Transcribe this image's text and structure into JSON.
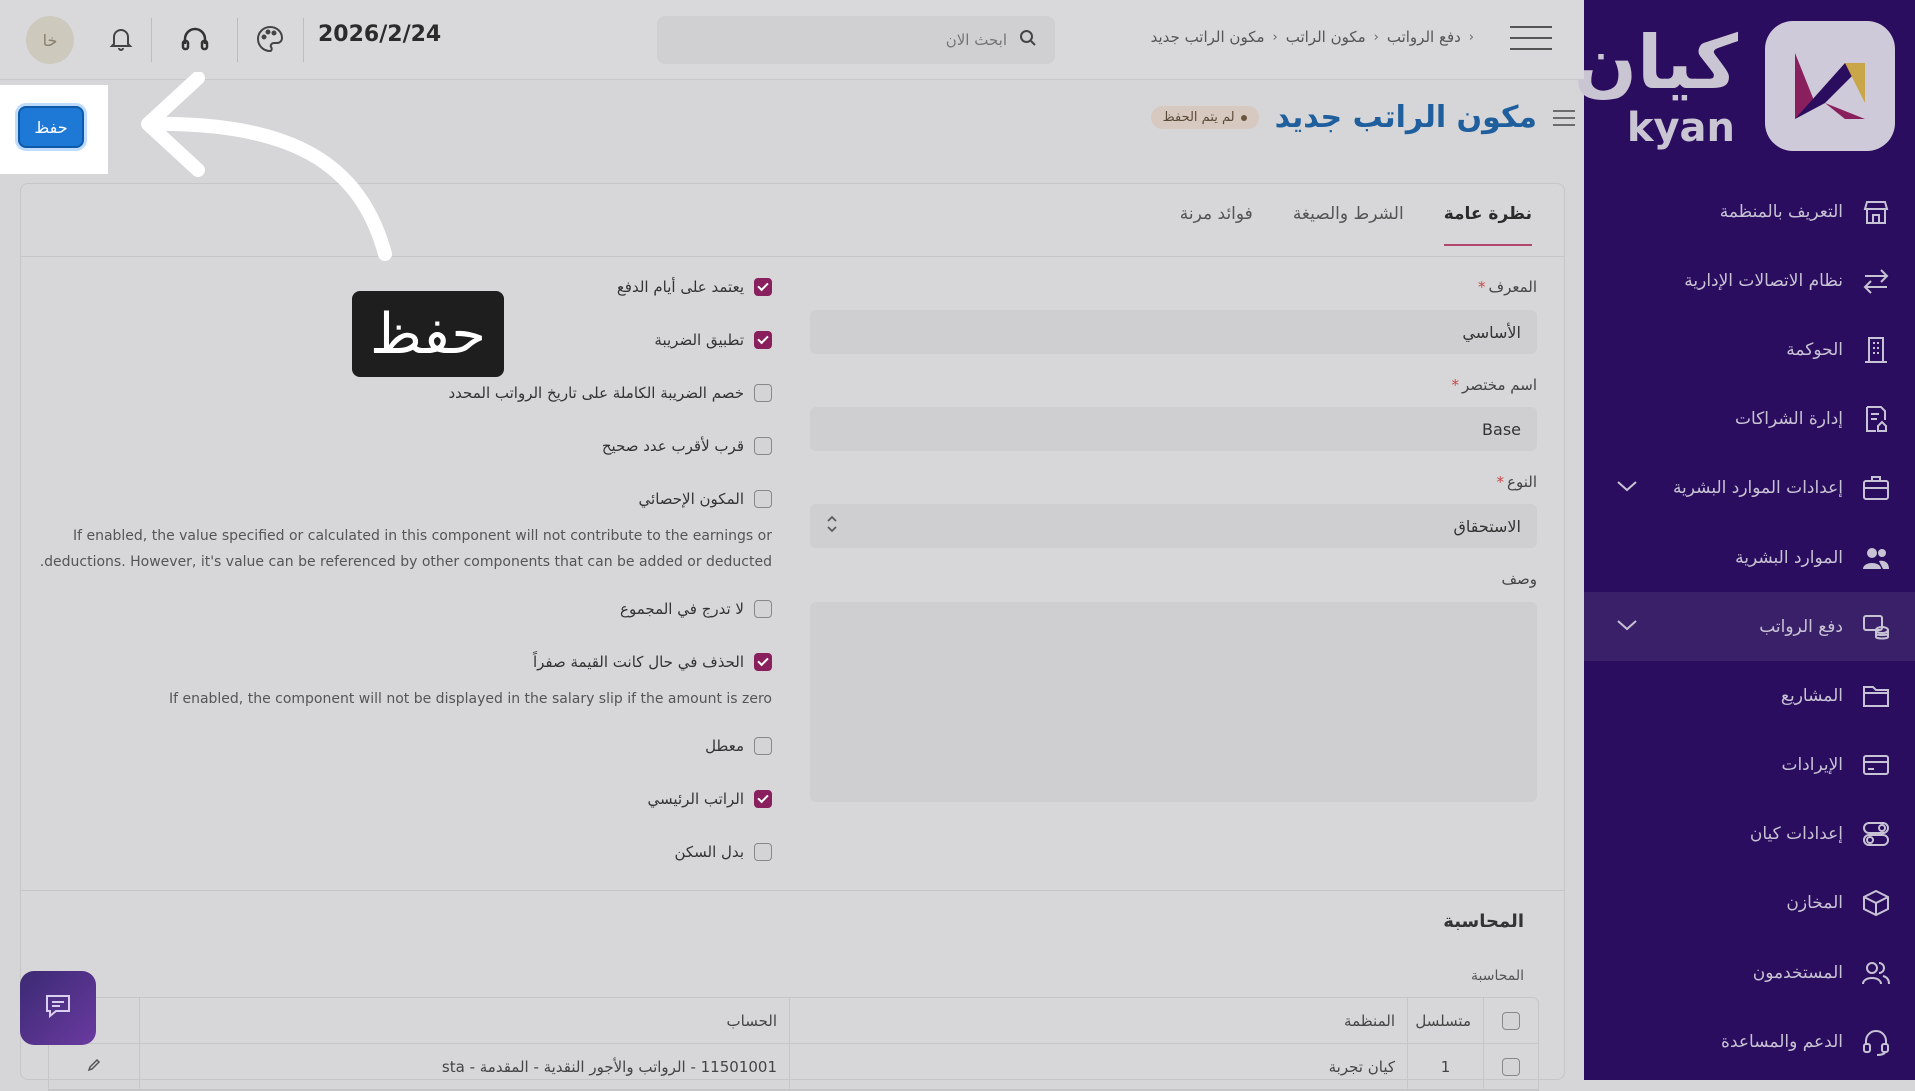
{
  "sidebar": {
    "logo_ar": "كيان",
    "logo_en": "kyan",
    "items": [
      {
        "label": "التعريف بالمنظمة",
        "icon": "store-icon"
      },
      {
        "label": "نظام الاتصالات الإدارية",
        "icon": "transfer-icon"
      },
      {
        "label": "الحوكمة",
        "icon": "building-icon"
      },
      {
        "label": "إدارة الشراكات",
        "icon": "document-home-icon"
      },
      {
        "label": "إعدادات الموارد البشرية",
        "icon": "briefcase-icon",
        "expandable": true
      },
      {
        "label": "الموارد البشرية",
        "icon": "users-icon"
      },
      {
        "label": "دفع الرواتب",
        "icon": "coins-icon",
        "expandable": true,
        "active": true
      },
      {
        "label": "المشاريع",
        "icon": "folder-icon"
      },
      {
        "label": "الإيرادات",
        "icon": "card-icon"
      },
      {
        "label": "إعدادات كيان",
        "icon": "toggles-icon"
      },
      {
        "label": "المخازن",
        "icon": "box-icon"
      },
      {
        "label": "المستخدمون",
        "icon": "user-group-icon"
      },
      {
        "label": "الدعم والمساعدة",
        "icon": "headset-icon"
      }
    ]
  },
  "topbar": {
    "breadcrumb": [
      "دفع الرواتب",
      "مكون الراتب",
      "مكون الراتب جديد"
    ],
    "search_placeholder": "ابحث الان",
    "date": "2026/2/24",
    "avatar": "خا"
  },
  "page": {
    "title": "مكون الراتب جديد",
    "status": "لم يتم الحفظ",
    "save_label": "حفظ",
    "tooltip": "حفظ"
  },
  "tabs": [
    "نظرة عامة",
    "الشرط والصيغة",
    "فوائد مرنة"
  ],
  "form": {
    "id_label": "المعرف",
    "id_value": "الأساسي",
    "abbr_label": "اسم مختصر",
    "abbr_value": "Base",
    "type_label": "النوع",
    "type_value": "الاستحقاق",
    "desc_label": "وصف"
  },
  "checkboxes": [
    {
      "label": "يعتمد على أيام الدفع",
      "checked": true
    },
    {
      "label": "تطبيق الضريبة",
      "checked": true
    },
    {
      "label": "خصم الضريبة الكاملة على تاريخ الرواتب المحدد",
      "checked": false
    },
    {
      "label": "قرب لأقرب عدد صحيح",
      "checked": false
    },
    {
      "label": "المكون الإحصائي",
      "checked": false
    },
    {
      "label": "لا تدرج في المجموع",
      "checked": false
    },
    {
      "label": "الحذف في حال كانت القيمة صفراً",
      "checked": true
    },
    {
      "label": "معطل",
      "checked": false
    },
    {
      "label": "الراتب الرئيسي",
      "checked": true
    },
    {
      "label": "بدل السكن",
      "checked": false
    }
  ],
  "help": {
    "statistical_1": "If enabled, the value specified or calculated in this component will not contribute to the earnings or",
    "statistical_2": ".deductions. However, it's value can be referenced by other components that can be added or deducted",
    "zero": "If enabled, the component will not be displayed in the salary slip if the amount is zero"
  },
  "accounting": {
    "section_title": "المحاسبة",
    "sub_label": "المحاسبة",
    "columns": [
      "متسلسل",
      "المنظمة",
      "الحساب"
    ],
    "rows": [
      {
        "num": "1",
        "org": "كيان تجربة",
        "account": "11501001 - الرواتب والأجور النقدية - المقدمة - sta"
      }
    ]
  }
}
